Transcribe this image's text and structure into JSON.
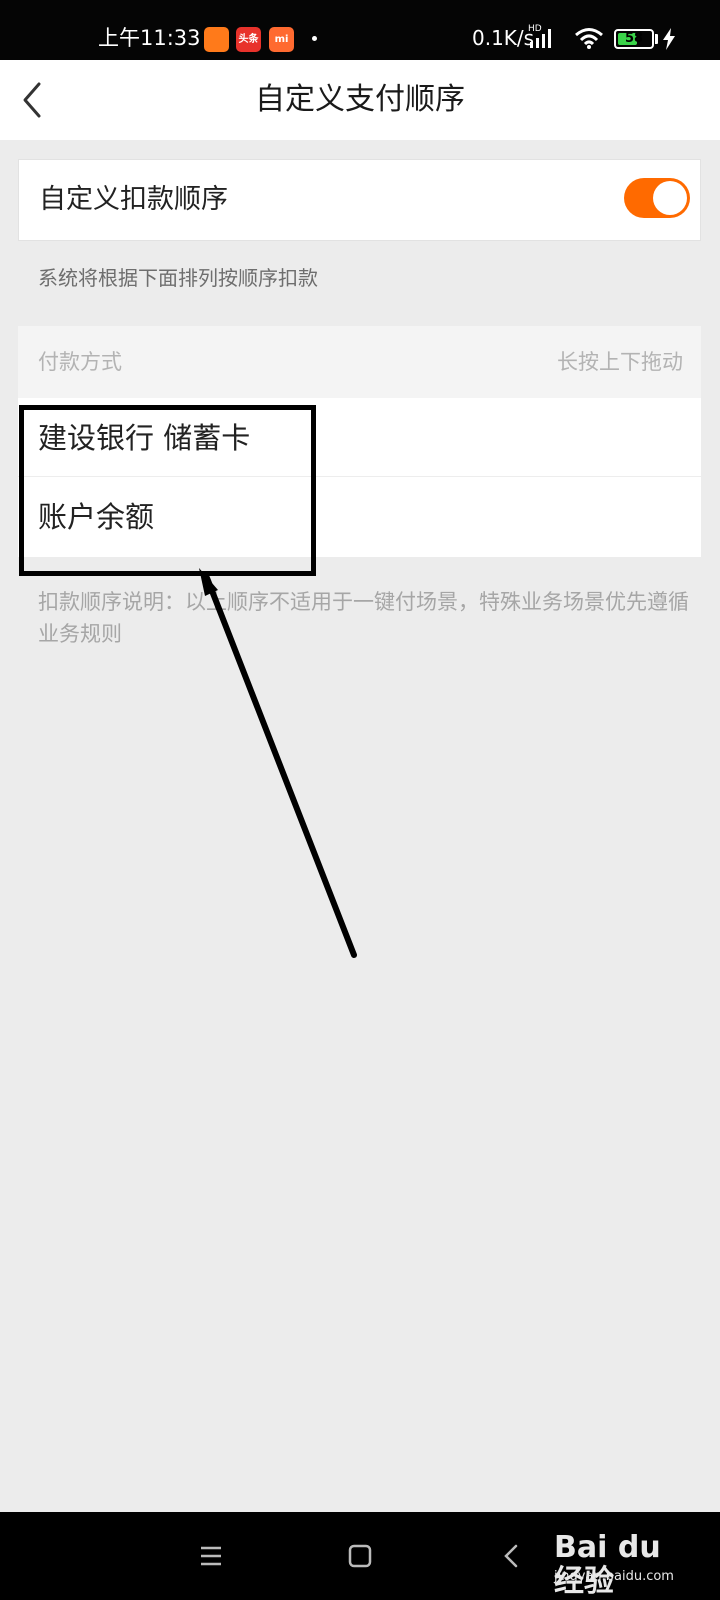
{
  "status_bar": {
    "time": "上午11:33",
    "apps": [
      {
        "name": "cart-app-icon",
        "label": "",
        "color": "#ff7a1a"
      },
      {
        "name": "toutiao-app-icon",
        "label": "头条",
        "color": "#e8322b"
      },
      {
        "name": "mi-app-icon",
        "label": "mi",
        "color": "#ff6a30"
      }
    ],
    "net_speed": "0.1K/s",
    "signal_tag": "HD",
    "battery": 58
  },
  "header": {
    "back_icon": "chevron-left-icon",
    "title": "自定义支付顺序"
  },
  "toggle_card": {
    "label": "自定义扣款顺序",
    "enabled": true,
    "accent": "#ff6a00"
  },
  "system_note": "系统将根据下面排列按顺序扣款",
  "list": {
    "header_left": "付款方式",
    "header_right": "长按上下拖动",
    "items": [
      {
        "label": "建设银行 储蓄卡"
      },
      {
        "label": "账户余额"
      }
    ]
  },
  "description": "扣款顺序说明：以上顺序不适用于一键付场景，特殊业务场景优先遵循业务规则",
  "nav_bar": {
    "buttons": [
      "menu-icon",
      "home-icon",
      "back-icon"
    ]
  },
  "watermark": {
    "logo": "Bai du 经验",
    "url": "jingyan.baidu.com"
  }
}
